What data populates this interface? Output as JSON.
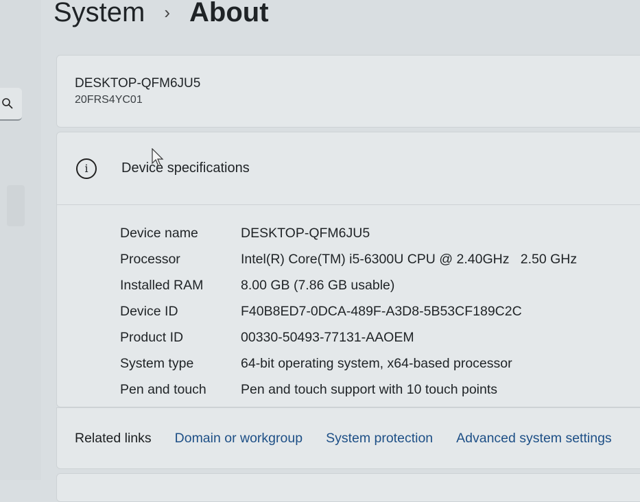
{
  "breadcrumb": {
    "parent": "System",
    "separator": "›",
    "current": "About"
  },
  "device_card": {
    "name": "DESKTOP-QFM6JU5",
    "model": "20FRS4YC01"
  },
  "specs": {
    "title": "Device specifications",
    "rows": [
      {
        "label": "Device name",
        "value": "DESKTOP-QFM6JU5"
      },
      {
        "label": "Processor",
        "value": "Intel(R) Core(TM) i5-6300U CPU @ 2.40GHz   2.50 GHz"
      },
      {
        "label": "Installed RAM",
        "value": "8.00 GB (7.86 GB usable)"
      },
      {
        "label": "Device ID",
        "value": "F40B8ED7-0DCA-489F-A3D8-5B53CF189C2C"
      },
      {
        "label": "Product ID",
        "value": "00330-50493-77131-AAOEM"
      },
      {
        "label": "System type",
        "value": "64-bit operating system, x64-based processor"
      },
      {
        "label": "Pen and touch",
        "value": "Pen and touch support with 10 touch points"
      }
    ]
  },
  "related_links": {
    "label": "Related links",
    "links": [
      "Domain or workgroup",
      "System protection",
      "Advanced system settings"
    ]
  }
}
